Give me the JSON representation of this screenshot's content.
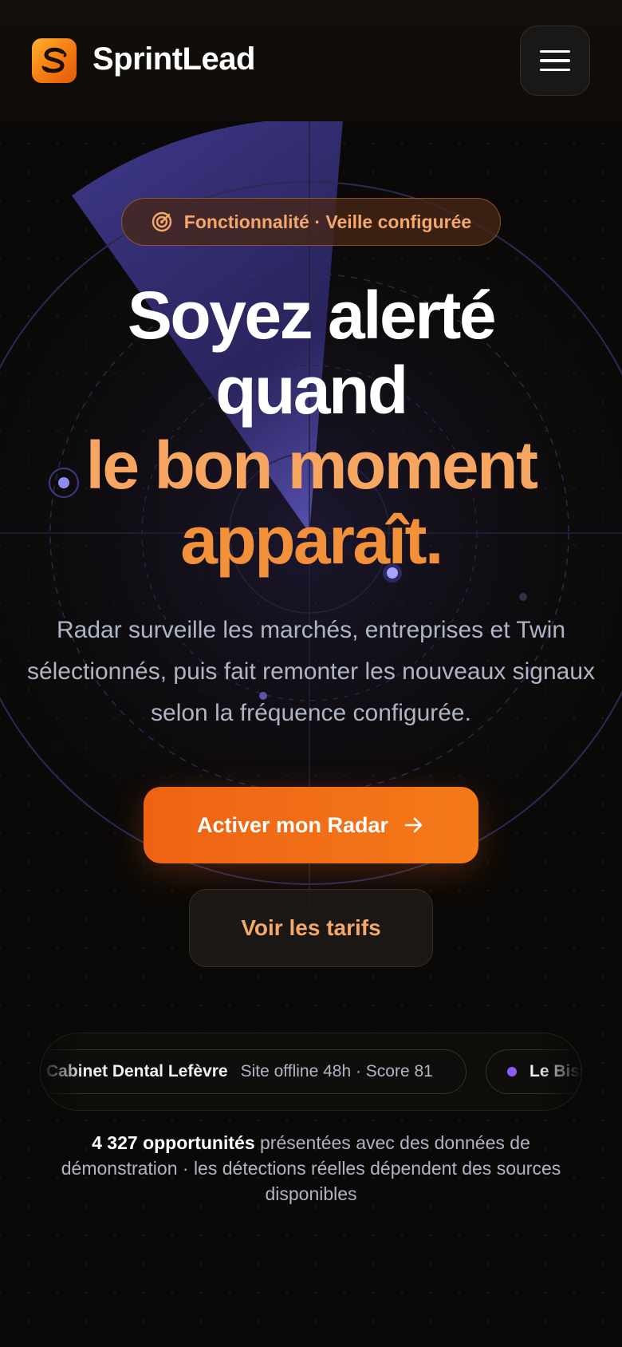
{
  "header": {
    "brand": "SprintLead",
    "logo_icon": "sprintlead-s-logo",
    "menu_icon": "hamburger-menu-icon"
  },
  "badge": {
    "icon": "radar-target-icon",
    "label": "Fonctionnalité · Veille configurée"
  },
  "hero": {
    "line1": "Soyez alerté",
    "line2": "quand",
    "line3": "le bon moment",
    "line4": "apparaît.",
    "subtitle": "Radar surveille les marchés, entreprises et Twin sélectionnés, puis fait remonter les nouveaux signaux selon la fréquence configurée."
  },
  "cta": {
    "primary_label": "Activer mon Radar",
    "primary_icon": "arrow-right-icon",
    "secondary_label": "Voir les tarifs"
  },
  "ticker": {
    "items": [
      {
        "name": "Cabinet Dental Lefèvre",
        "meta": "Site offline 48h · Score 81"
      },
      {
        "name": "Le Bistrot",
        "meta": ""
      }
    ]
  },
  "stats": {
    "count": "4 327 opportunités",
    "text": " présentées avec des données de démonstration · les détections réelles dépendent des sources disponibles"
  },
  "colors": {
    "accent_orange": "#f47a18",
    "headline_orange": "#f6a660",
    "radar_purple": "#5b52c7",
    "background": "#0b0907"
  }
}
